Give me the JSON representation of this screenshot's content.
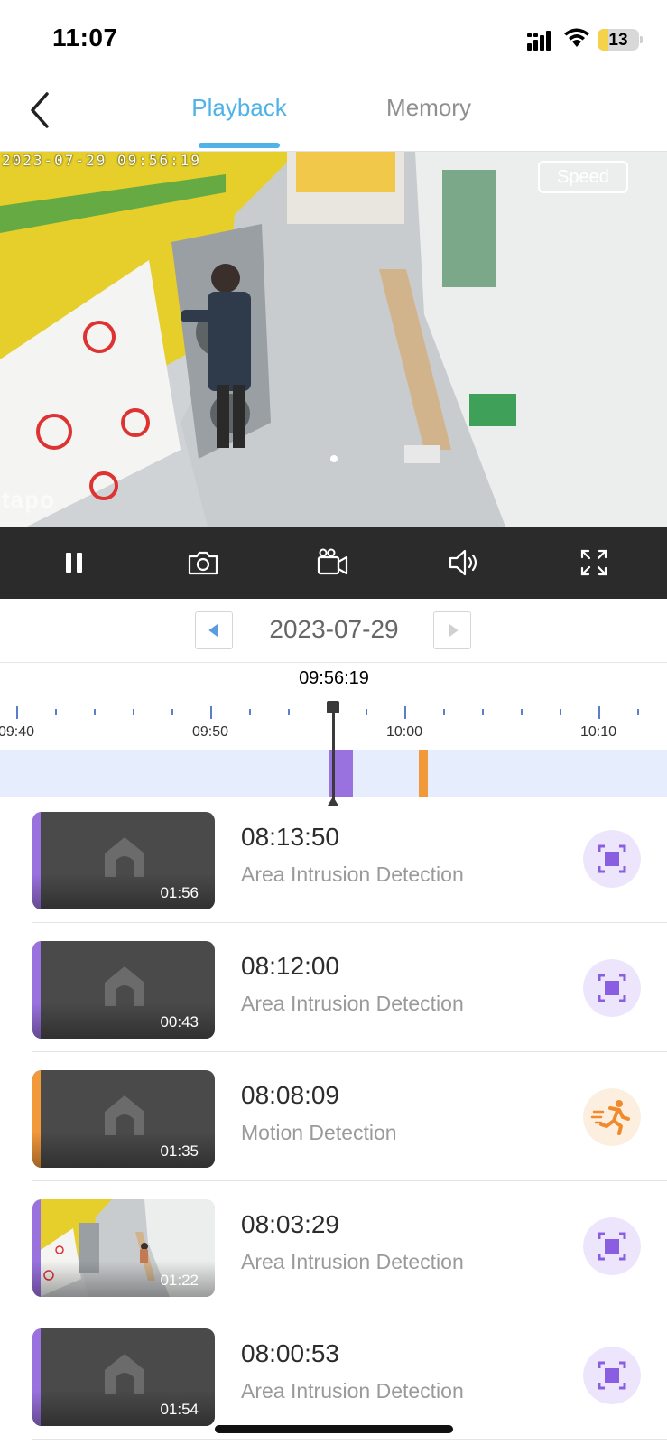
{
  "status_bar": {
    "time": "11:07",
    "battery": "13",
    "battery_level": 0.13,
    "icons": [
      "signal-icon",
      "wifi-icon",
      "battery-icon"
    ]
  },
  "header": {
    "back_icon": "chevron-left-icon",
    "tabs": [
      {
        "label": "Playback",
        "active": true
      },
      {
        "label": "Memory",
        "active": false
      }
    ],
    "accent_color": "#4fb3e8"
  },
  "video": {
    "overlay_timestamp": "2023-07-29  09:56:19",
    "speed_label": "Speed",
    "watermark": "tapo"
  },
  "controls": [
    "pause-icon",
    "camera-snapshot-icon",
    "video-record-icon",
    "volume-icon",
    "fullscreen-icon"
  ],
  "date_selector": {
    "date": "2023-07-29"
  },
  "timeline": {
    "current_time": "09:56:19",
    "labels": [
      "09:40",
      "09:50",
      "10:00",
      "10:10"
    ],
    "segment_colors": {
      "intrusion": "#9a72e0",
      "motion": "#f2993a"
    }
  },
  "events": [
    {
      "time": "08:13:50",
      "type": "Area Intrusion Detection",
      "duration": "01:56",
      "kind": "intrusion",
      "badge_icon": "area-intrusion-icon"
    },
    {
      "time": "08:12:00",
      "type": "Area Intrusion Detection",
      "duration": "00:43",
      "kind": "intrusion",
      "badge_icon": "area-intrusion-icon"
    },
    {
      "time": "08:08:09",
      "type": "Motion Detection",
      "duration": "01:35",
      "kind": "motion",
      "badge_icon": "running-person-icon"
    },
    {
      "time": "08:03:29",
      "type": "Area Intrusion Detection",
      "duration": "01:22",
      "kind": "intrusion",
      "badge_icon": "area-intrusion-icon"
    },
    {
      "time": "08:00:53",
      "type": "Area Intrusion Detection",
      "duration": "01:54",
      "kind": "intrusion",
      "badge_icon": "area-intrusion-icon"
    }
  ]
}
